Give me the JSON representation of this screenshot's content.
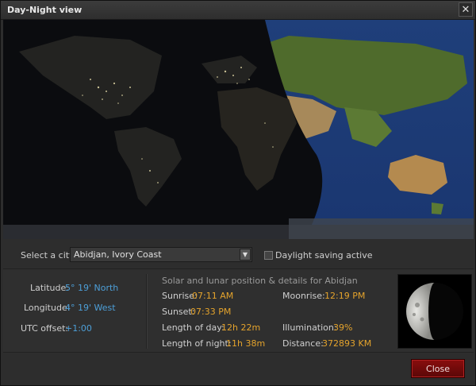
{
  "window": {
    "title": "Day-Night view",
    "close_glyph": "✕"
  },
  "controls": {
    "city_label": "Select a city:",
    "city_value": "Abidjan, Ivory Coast",
    "dropdown_glyph": "▼",
    "dst_label": "Daylight saving active",
    "dst_checked": false
  },
  "location": {
    "latitude_label": "Latitude:",
    "latitude_value": "5° 19' North",
    "longitude_label": "Longitude:",
    "longitude_value": "4° 19' West",
    "utc_label": "UTC offset:",
    "utc_value": "+1:00"
  },
  "details": {
    "title": "Solar and lunar position & details for Abidjan",
    "sunrise_label": "Sunrise:",
    "sunrise_value": "07:11 AM",
    "sunset_label": "Sunset:",
    "sunset_value": "07:33 PM",
    "day_length_label": "Length of day:",
    "day_length_value": "12h 22m",
    "night_length_label": "Length of night:",
    "night_length_value": "11h 38m",
    "moonrise_label": "Moonrise:",
    "moonrise_value": "12:19 PM",
    "illumination_label": "Illumination:",
    "illumination_value": "39%",
    "distance_label": "Distance:",
    "distance_value": "372893 KM"
  },
  "moon": {
    "illumination_fraction": 0.39
  },
  "footer": {
    "close_label": "Close"
  },
  "colors": {
    "value_blue": "#4d9fd8",
    "value_yellow": "#e4a32c",
    "close_red": "#7a0b0b"
  }
}
